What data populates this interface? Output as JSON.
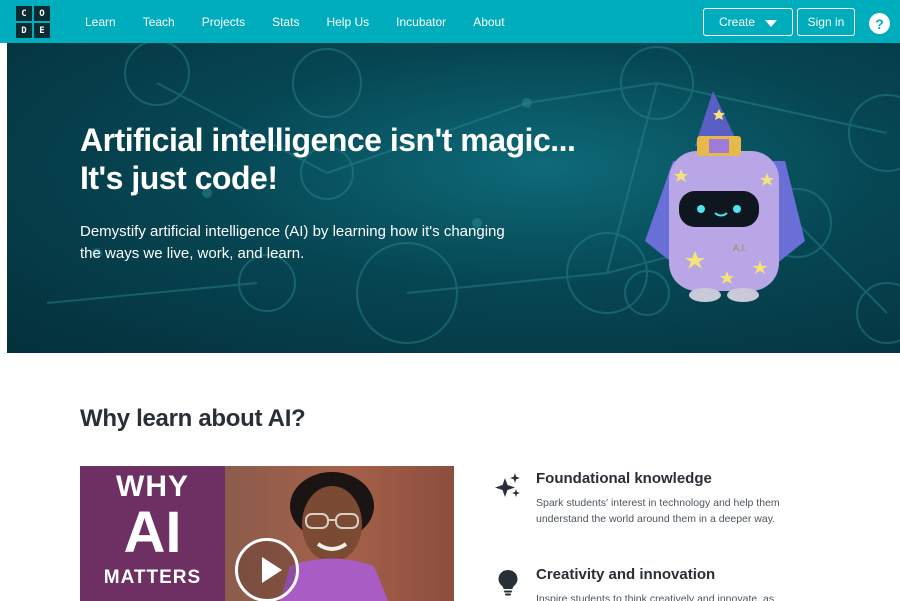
{
  "logo": {
    "letters": [
      "C",
      "O",
      "D",
      "E"
    ]
  },
  "nav": {
    "items": [
      "Learn",
      "Teach",
      "Projects",
      "Stats",
      "Help Us",
      "Incubator",
      "About"
    ],
    "create_label": "Create",
    "signin_label": "Sign in",
    "help_label": "?"
  },
  "hero": {
    "title_line1": "Artificial intelligence isn't magic...",
    "title_line2": "It's just code!",
    "subtitle": "Demystify artificial intelligence (AI) by learning how it's changing the ways we live, work, and learn.",
    "robot_badge": "A.I."
  },
  "section": {
    "title": "Why learn about AI?",
    "video": {
      "line1": "WHY",
      "line2": "AI",
      "line3": "MATTERS"
    },
    "features": [
      {
        "icon": "sparkles-icon",
        "title": "Foundational knowledge",
        "text": "Spark students' interest in technology and help them understand the world around them in a deeper way."
      },
      {
        "icon": "lightbulb-icon",
        "title": "Creativity and innovation",
        "text": "Inspire students to think creatively and innovate, as"
      }
    ]
  },
  "colors": {
    "nav_bg": "#00adbc",
    "hero_bg": "#064653",
    "text_dark": "#292f36"
  }
}
